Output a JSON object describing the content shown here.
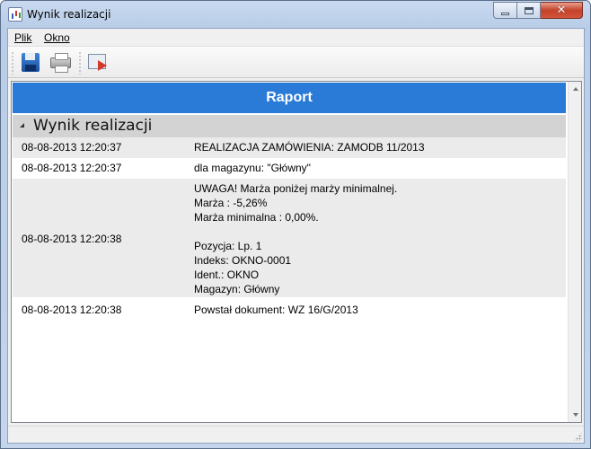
{
  "window": {
    "title": "Wynik realizacji"
  },
  "menu": {
    "items": [
      {
        "label": "Plik"
      },
      {
        "label": "Okno"
      }
    ]
  },
  "toolbar": {
    "buttons": [
      {
        "icon": "floppy-disk-icon"
      },
      {
        "icon": "printer-icon"
      },
      {
        "icon": "export-icon"
      }
    ]
  },
  "report": {
    "header": "Raport",
    "section_title": "Wynik realizacji",
    "rows": [
      {
        "date": "08-08-2013 12:20:37",
        "lines": [
          "REALIZACJA ZAMÓWIENIA: ZAMODB 11/2013"
        ]
      },
      {
        "date": "08-08-2013 12:20:37",
        "lines": [
          "dla magazynu: \"Główny\""
        ]
      },
      {
        "date": "08-08-2013 12:20:38",
        "lines": [
          "UWAGA! Marża poniżej marży minimalnej.",
          "Marża : -5,26%",
          "Marża minimalna : 0,00%.",
          "",
          "Pozycja: Lp. 1",
          "Indeks: OKNO-0001",
          "Ident.: OKNO",
          "Magazyn: Główny"
        ]
      },
      {
        "date": "08-08-2013 12:20:38",
        "lines": [
          "Powstał dokument: WZ 16/G/2013"
        ]
      }
    ]
  },
  "colors": {
    "report_header_bg": "#2a7ad8",
    "section_header_bg": "#d3d3d3",
    "alt_row_bg": "#ebebeb",
    "close_button": "#c4422b"
  }
}
